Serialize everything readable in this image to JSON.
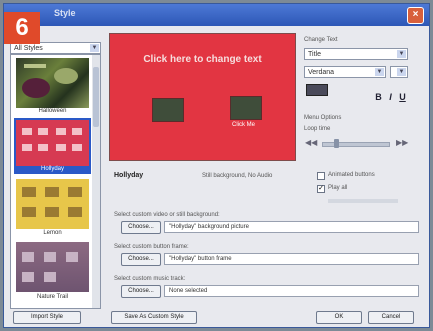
{
  "step_badge": "6",
  "window": {
    "title": "Style",
    "close": "×"
  },
  "style_selector": {
    "value": "All Styles"
  },
  "style_list": [
    {
      "label": "Halloween"
    },
    {
      "label": "Hollyday"
    },
    {
      "label": "Lemon"
    },
    {
      "label": "Nature Trail"
    }
  ],
  "preview": {
    "headline": "Click here to change text",
    "button_label": "Click Me"
  },
  "change_text": {
    "heading": "Change Text",
    "type_value": "Title",
    "font_value": "Verdana",
    "bold": "B",
    "italic": "I",
    "underline": "U"
  },
  "menu_options": {
    "heading": "Menu Options",
    "loop_label": "Loop time"
  },
  "summary": {
    "name": "Hollyday",
    "background": "Still background, No Audio"
  },
  "animated_buttons": {
    "label": "Animated buttons"
  },
  "play_all": {
    "label": "Play all"
  },
  "custom_background": {
    "label": "Select custom video or still background:",
    "button": "Choose...",
    "value": "\"Hollyday\" background picture"
  },
  "custom_button": {
    "label": "Select custom button frame:",
    "button": "Choose...",
    "value": "\"Hollyday\" button frame"
  },
  "custom_music": {
    "label": "Select custom music track:",
    "button": "Choose...",
    "value": "None selected"
  },
  "footer": {
    "import": "Import Style",
    "save_custom": "Save As Custom Style",
    "ok": "OK",
    "cancel": "Cancel"
  },
  "colors": {
    "badge": "#e04a2a",
    "preview_bg": "#e23542",
    "titlebar": "#3a66c8"
  }
}
